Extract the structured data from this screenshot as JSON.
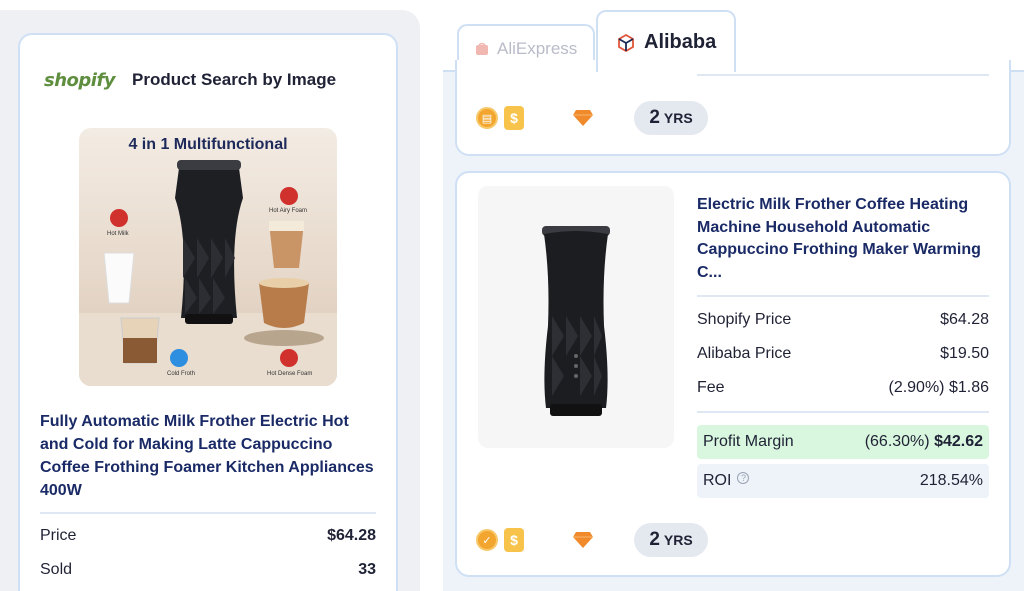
{
  "left": {
    "brand_logo": "shopify",
    "title": "Product Search by Image",
    "image_headline": "4 in 1 Multifunctional",
    "image_labels": {
      "hot_milk": "Hot Milk",
      "hot_airy_foam": "Hot Airy Foam",
      "cold_froth": "Cold Froth",
      "hot_dense_foam": "Hot Dense Foam"
    },
    "product_title": "Fully Automatic Milk Frother Electric Hot and Cold for Making Latte Cappuccino Coffee Frothing Foamer Kitchen Appliances 400W",
    "stats": [
      {
        "label": "Price",
        "value": "$64.28"
      },
      {
        "label": "Sold",
        "value": "33"
      }
    ]
  },
  "tabs": [
    {
      "label": "AliExpress",
      "icon": "aliexpress-icon",
      "active": false
    },
    {
      "label": "Alibaba",
      "icon": "alibaba-icon",
      "active": true
    }
  ],
  "top_card": {
    "years_num": "2",
    "years_unit": "YRS"
  },
  "main_card": {
    "title": "Electric Milk Frother Coffee Heating Machine Household Automatic Cappuccino Frothing Maker Warming C...",
    "shopify_price_label": "Shopify Price",
    "shopify_price": "$64.28",
    "alibaba_price_label": "Alibaba Price",
    "alibaba_price": "$19.50",
    "fee_label": "Fee",
    "fee_value": "(2.90%) $1.86",
    "profit_label": "Profit Margin",
    "profit_pct": "(66.30%)",
    "profit_value": "$42.62",
    "roi_label": "ROI",
    "roi_value": "218.54%",
    "years_num": "2",
    "years_unit": "YRS"
  },
  "colors": {
    "accent_navy": "#1a2a66",
    "shopify_green": "#5e8e3e",
    "profit_bg": "#d9f7df",
    "border_blue": "#cfe0f5"
  }
}
